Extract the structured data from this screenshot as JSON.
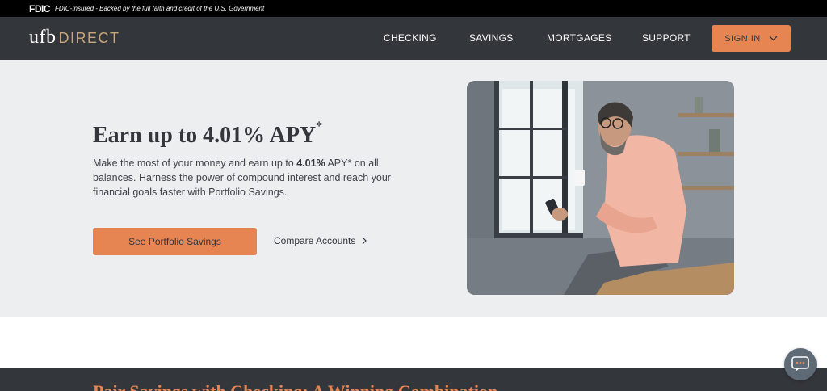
{
  "fdic_bar": {
    "logo": "FDIC",
    "text": "FDIC-Insured - Backed by the full faith and credit of the U.S. Government"
  },
  "header": {
    "logo_ufb": "ufb",
    "logo_direct": "DIRECT",
    "nav": [
      {
        "label": "CHECKING"
      },
      {
        "label": "SAVINGS"
      },
      {
        "label": "MORTGAGES"
      },
      {
        "label": "SUPPORT"
      }
    ],
    "signin_label": "SIGN IN"
  },
  "hero": {
    "title": "Earn up to 4.01% APY",
    "title_sup": "*",
    "desc_before": "Make the most of your money and earn up to ",
    "desc_bold": "4.01%",
    "desc_after": " APY* on all balances. Harness the power of compound interest and reach your financial goals faster with Portfolio Savings.",
    "primary_button": "See Portfolio Savings",
    "secondary_link": "Compare Accounts"
  },
  "lower": {
    "heading": "Pair Savings with Checking: A Winning Combination"
  },
  "colors": {
    "accent": "#e68452",
    "dark": "#33363b",
    "hero_bg": "#eceef0",
    "brand_gold": "#c9a57a"
  },
  "icons": {
    "chat": "chat-bubble-icon",
    "chevron_signin": "chevron-down-icon",
    "chevron_compare": "chevron-right-icon"
  }
}
